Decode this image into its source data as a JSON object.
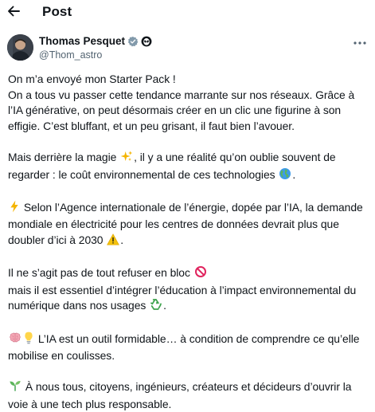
{
  "header": {
    "title": "Post",
    "back_icon": "arrow-left-icon"
  },
  "author": {
    "name": "Thomas Pesquet",
    "handle": "@Thom_astro",
    "verified_badge": "verified-check-icon",
    "affiliate_badge": "alien-icon",
    "more_icon": "more-options-icon"
  },
  "tweet": {
    "l1": "On m’a envoyé mon Starter Pack !",
    "l2": "On a tous vu passer cette tendance marrante sur nos réseaux. Grâce à",
    "l3": "l’IA générative, on peut désormais créer en un clic une figurine à son",
    "l4": "effigie. C’est bluffant, et un peu grisant, il faut bien l’avouer.",
    "l5": "Mais derrière la magie",
    "l5b": ", il y a une réalité qu’on oublie souvent de",
    "l6": "regarder : le coût environnemental de ces technologies",
    "l7": "Selon l’Agence internationale de l’énergie, dopée par l’IA, la demande",
    "l8": "mondiale en électricité pour les centres de données devrait plus que",
    "l9": "doubler d’ici à 2030",
    "l10": "Il ne s’agit pas de tout refuser en bloc",
    "l11": "mais il est essentiel d’intégrer l’éducation à l’impact environnemental du",
    "l12": "numérique dans nos usages",
    "l13": "L’IA est un outil formidable… à condition de comprendre ce qu’elle",
    "l14": "mobilise en coulisses.",
    "l15": "À nous tous, citoyens, ingénieurs, créateurs et décideurs d’ouvrir la",
    "l16": "voie à une tech plus responsable."
  },
  "colors": {
    "text": "#0f1419",
    "secondary": "#536471",
    "verified": "#829aab"
  }
}
